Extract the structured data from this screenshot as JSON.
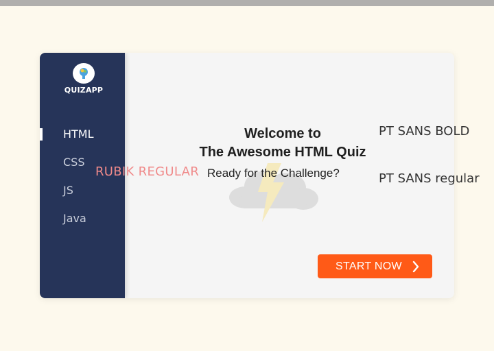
{
  "app": {
    "logo_text": "QUIZAPP",
    "logo_icon": "brain-head-icon"
  },
  "sidebar": {
    "items": [
      {
        "label": "HTML",
        "active": true
      },
      {
        "label": "CSS",
        "active": false
      },
      {
        "label": "JS",
        "active": false
      },
      {
        "label": "Java",
        "active": false
      }
    ]
  },
  "main": {
    "title_line1": "Welcome to",
    "title_line2": "The Awesome HTML Quiz",
    "subtitle": "Ready for the Challenge?",
    "illustration": "storm-cloud-icon"
  },
  "font_notes": {
    "rubik": "RUBIK REGULAR",
    "pt_bold": "PT SANS BOLD",
    "pt_regular": "PT SANS regular"
  },
  "start_button": {
    "label": "START NOW",
    "icon": "chevron-right-icon"
  },
  "colors": {
    "page_bg": "#fdf9ed",
    "sidebar_bg": "#263459",
    "accent": "#ff5a17",
    "card_bg": "#f5f5f5",
    "note_pink": "#f08a8a"
  }
}
